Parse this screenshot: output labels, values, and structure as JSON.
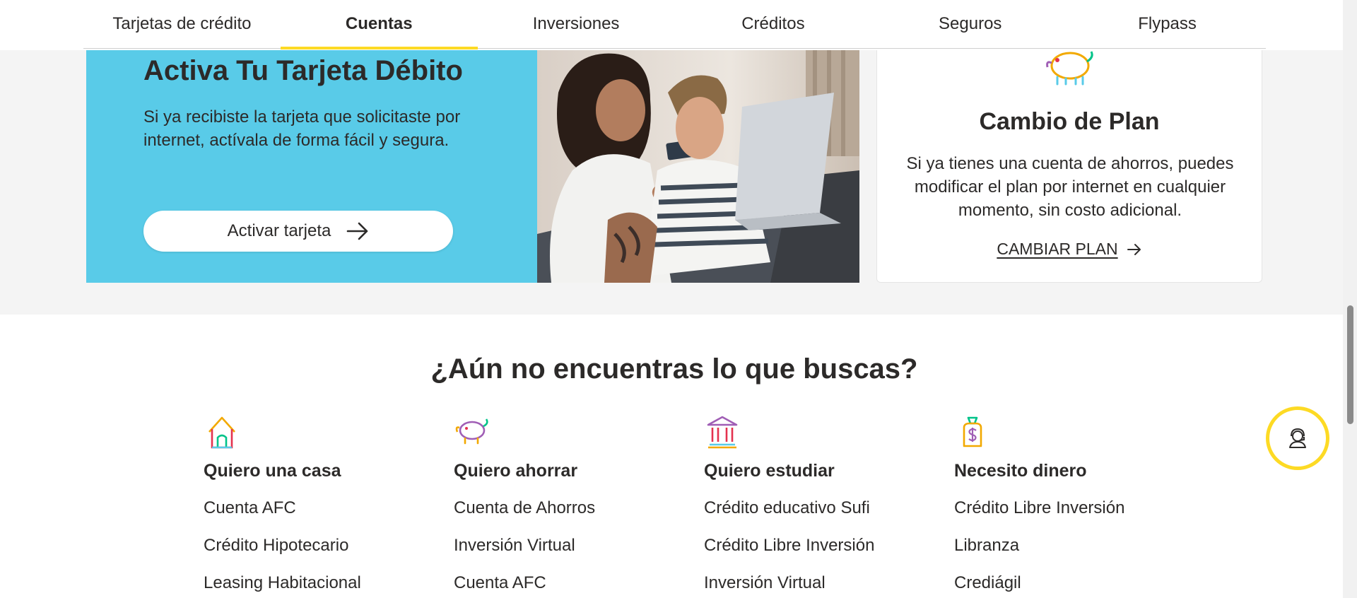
{
  "nav": {
    "tabs": [
      {
        "label": "Tarjetas de crédito"
      },
      {
        "label": "Cuentas"
      },
      {
        "label": "Inversiones"
      },
      {
        "label": "Créditos"
      },
      {
        "label": "Seguros"
      },
      {
        "label": "Flypass"
      }
    ],
    "active_tab": "Cuentas"
  },
  "promo": {
    "title": "Activa Tu Tarjeta Débito",
    "text": "Si ya recibiste la tarjeta que solicitaste por internet, actívala de forma fácil y segura.",
    "button_label": "Activar tarjeta",
    "button_icon": "arrow-right-icon",
    "background_color": "#59cbe8"
  },
  "plan_card": {
    "icon": "piggy-bank-icon",
    "title": "Cambio de Plan",
    "text": "Si ya tienes una cuenta de ahorros, puedes modificar el plan por internet en cualquier momento, sin costo adicional.",
    "link_label": "CAMBIAR PLAN",
    "link_icon": "arrow-right-icon"
  },
  "help": {
    "title": "¿Aún no encuentras lo que buscas?",
    "columns": [
      {
        "icon": "house-icon",
        "heading": "Quiero una casa",
        "links": [
          "Cuenta AFC",
          "Crédito Hipotecario",
          "Leasing Habitacional"
        ]
      },
      {
        "icon": "piggy-bank-icon",
        "heading": "Quiero ahorrar",
        "links": [
          "Cuenta de Ahorros",
          "Inversión Virtual",
          "Cuenta AFC"
        ]
      },
      {
        "icon": "bank-building-icon",
        "heading": "Quiero estudiar",
        "links": [
          "Crédito educativo Sufi",
          "Crédito Libre Inversión",
          "Inversión Virtual"
        ]
      },
      {
        "icon": "money-bag-icon",
        "heading": "Necesito dinero",
        "links": [
          "Crédito Libre Inversión",
          "Libranza",
          "Crediágil"
        ]
      }
    ]
  },
  "chat": {
    "icon": "support-agent-icon",
    "accent_color": "#fdda24"
  }
}
